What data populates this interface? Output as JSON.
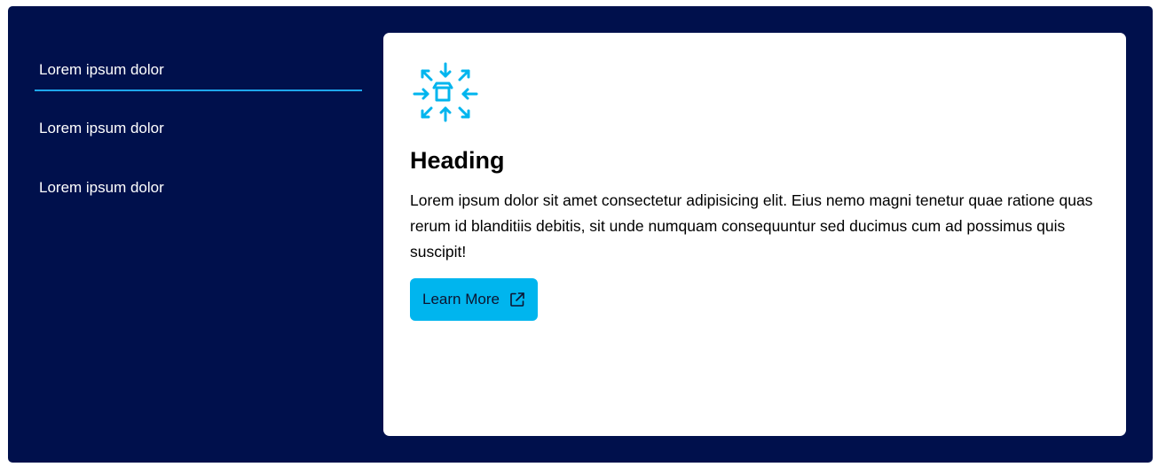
{
  "tabs": [
    {
      "label": "Lorem ipsum dolor",
      "active": true
    },
    {
      "label": "Lorem ipsum dolor",
      "active": false
    },
    {
      "label": "Lorem ipsum dolor",
      "active": false
    }
  ],
  "card": {
    "icon": "distribution-box-icon",
    "heading": "Heading",
    "body": "Lorem ipsum dolor sit amet consectetur adipisicing elit. Eius nemo magni tenetur quae ratione quas rerum id blanditiis debitis, sit unde numquam consequuntur sed ducimus cum ad possimus quis suscipit!",
    "button_label": "Learn More",
    "button_icon": "external-link-icon"
  },
  "colors": {
    "background": "#00104c",
    "accent": "#00b5ee",
    "tab_underline": "#1ea7ef",
    "card": "#ffffff"
  }
}
